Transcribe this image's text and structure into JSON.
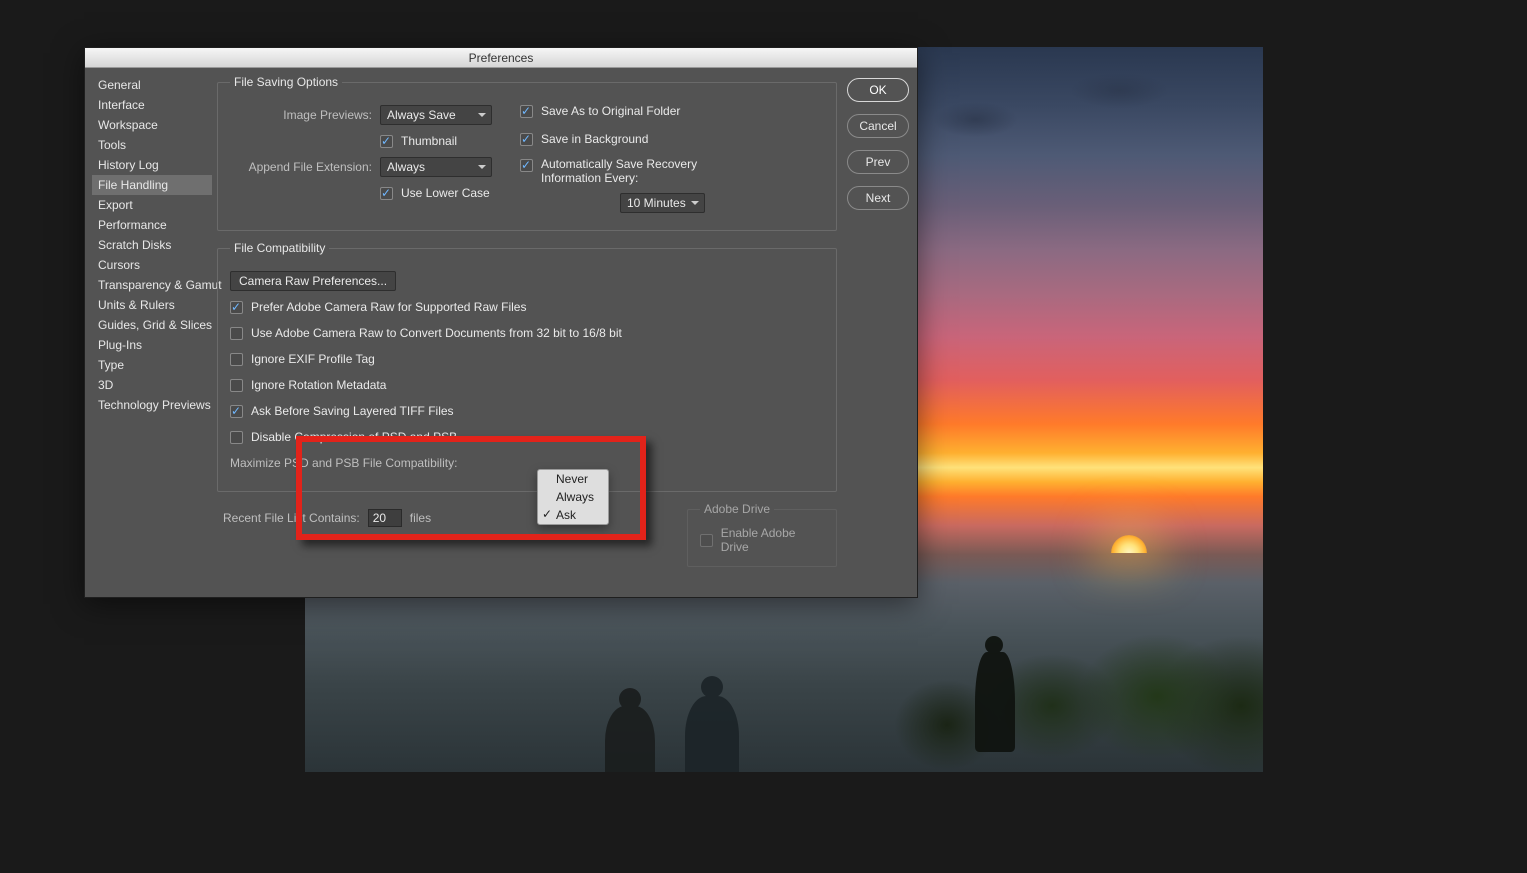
{
  "dialog": {
    "title": "Preferences"
  },
  "sidebar": {
    "items": [
      "General",
      "Interface",
      "Workspace",
      "Tools",
      "History Log",
      "File Handling",
      "Export",
      "Performance",
      "Scratch Disks",
      "Cursors",
      "Transparency & Gamut",
      "Units & Rulers",
      "Guides, Grid & Slices",
      "Plug-Ins",
      "Type",
      "3D",
      "Technology Previews"
    ],
    "selected_index": 5
  },
  "buttons": {
    "ok": "OK",
    "cancel": "Cancel",
    "prev": "Prev",
    "next": "Next"
  },
  "fso": {
    "legend": "File Saving Options",
    "image_previews_label": "Image Previews:",
    "image_previews_value": "Always Save",
    "thumbnail_label": "Thumbnail",
    "append_ext_label": "Append File Extension:",
    "append_ext_value": "Always",
    "lower_case_label": "Use Lower Case",
    "save_as_original": "Save As to Original Folder",
    "save_bg": "Save in Background",
    "auto_save_label": "Automatically Save Recovery Information Every:",
    "auto_save_value": "10 Minutes"
  },
  "fc": {
    "legend": "File Compatibility",
    "camera_raw_btn": "Camera Raw Preferences...",
    "prefer_raw": "Prefer Adobe Camera Raw for Supported Raw Files",
    "use_acr_convert": "Use Adobe Camera Raw to Convert Documents from 32 bit to 16/8 bit",
    "ignore_exif": "Ignore EXIF Profile Tag",
    "ignore_rotation": "Ignore Rotation Metadata",
    "ask_tiff": "Ask Before Saving Layered TIFF Files",
    "disable_compress": "Disable Compression of PSD and PSB",
    "maximize_label": "Maximize PSD and PSB File Compatibility:",
    "maximize_options": [
      "Never",
      "Always",
      "Ask"
    ],
    "maximize_selected": "Ask"
  },
  "drive": {
    "legend": "Adobe Drive",
    "enable": "Enable Adobe Drive"
  },
  "recent": {
    "label": "Recent File List Contains:",
    "value": "20",
    "suffix": "files"
  }
}
